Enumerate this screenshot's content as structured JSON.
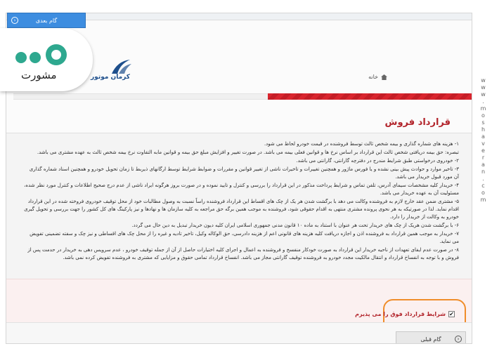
{
  "watermark": {
    "brand_text": "مشورت"
  },
  "site": {
    "logo_text": "کرمان موتور"
  },
  "breadcrumb": {
    "home_label": "خانه"
  },
  "page": {
    "title": "قرارداد فروش"
  },
  "terms": [
    "۱- هزینه های شماره گذاری و بیمه شخص ثالث توسط فروشنده در قیمت خودرو لحاظ می شود.",
    "تبصره: حق بیمه دریافتی شخص ثالث این قرارداد بر اساس نرخ ها و قوانین فعلی بیمه می باشد. در صورت تغییر و افزایش مبلغ حق بیمه و قوانین مابه التفاوت نرخ بیمه شخص ثالث به عهده مشتری می باشد.",
    "۲- خودروی درخواستی طبق شرایط مندرج در دفترچه گارانتی، گارانتی می باشد.",
    "۳- تاخیر موارد و حوادث پیش بینی نشده و یا فورس ماژور و همچنین تغییرات و تاخیرات ناشی از تغییر قوانین و مقررات و ضوابط شرایط توسط ارگانهای ذیربط تا زمان تحویل خودرو و همچنین اسناد شماره گذاری آن مورد قبول خریدار می باشد.",
    "۴- خریدار کلیه مشخصات سیمای آدرس، تلفن تماس و شرایط پرداخت مذکور در این قرارداد را بررسی و کنترل و تایید نموده و در صورت بروز هرگونه ایراد ناشی از عدم درج صحیح اطلاعات و کنترل مورد نظر شده، مسئولیت آن به عهده خریدار می باشد.",
    "۵- مشتری ضمن عقد خارج لازم به فروشنده وکالت می دهد با برگشت شدن هر یک از چک های اقساط این قرارداد فروشنده راساً نسبت به وصول مطالبات خود از محل توقیف خودروی فروخته شده در این قرارداد اقدام نماید. لذا در صورتیکه به هر نحوی پرونده مشتری منتهی به اقدام حقوقی شود، فروشنده به موجب همین برگه حق مراجعه به کلیه سازمان ها و نهادها و نیز پارکینگ های کل کشور را جهت بررسی و تحویل گیری خودرو به وکالت از خریدار را دارد.",
    "۶- با برگشت شدن هریک از چک های خریدار تحت هر عنوان با استناد به ماده ۱۰ قانون مدنی جمهوری اسلامی ایران کلیه دیون خریدار تبدیل به دین حال می گردد.",
    "۷- خریدار به موجب همین قرارداد به فروشنده اذن و اجازه دریافت کلیه هزینه های قانونی اعم از هزینه دادرسی، حق الوکاله وکیل، تاخیر تادیه و غیره را از محل چک های اقساطی و نیز چک و سفته تضمینی تفویض می نماید.",
    "۸- در صورت عدم ایفای تعهدات از ناحیه خریدار این قرارداد به صورت خودکار منفسخ و فروشنده به اعمال و اجرای کلیه اختیارات حاصل از آن از جمله توقیف خودرو ، عدم سرویس دهی به خریدار در حدمت پس از فروش و با توجه به انفساخ قرارداد و انتقال مالکیت مجدد خودرو به فروشنده توقیف گارانتی مجاز می باشد. انفساخ قرارداد تمامی حقوق و مزایایی که مشتری به فروشنده تفویض کرده نمی باشد."
  ],
  "accept": {
    "label": "شرایط قرارداد فوق را می پذیرم",
    "checked": true
  },
  "buttons": {
    "next_label": "گام بعدی",
    "prev_label": "گام قبلی"
  },
  "side_url": "www.moshaveran.com",
  "colors": {
    "accent_red": "#b2242b",
    "highlight_orange": "#f08d2a",
    "button_blue": "#3d8de0",
    "watermark_green": "#2ea88f"
  }
}
